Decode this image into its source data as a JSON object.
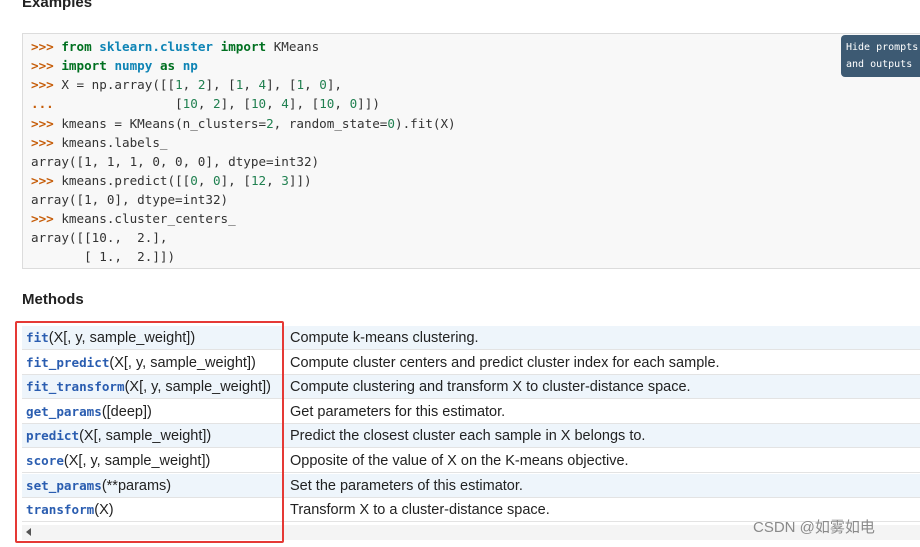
{
  "examples_heading": "Examples",
  "methods_heading": "Methods",
  "toggle_button": "Hide prompts\nand outputs",
  "methods": [
    {
      "name": "fit",
      "params": "(X[, y, sample_weight])",
      "description": "Compute k-means clustering."
    },
    {
      "name": "fit_predict",
      "params": "(X[, y, sample_weight])",
      "description": "Compute cluster centers and predict cluster index for each sample."
    },
    {
      "name": "fit_transform",
      "params": "(X[, y, sample_weight])",
      "description": "Compute clustering and transform X to cluster-distance space."
    },
    {
      "name": "get_params",
      "params": "([deep])",
      "description": "Get parameters for this estimator."
    },
    {
      "name": "predict",
      "params": "(X[, sample_weight])",
      "description": "Predict the closest cluster each sample in X belongs to."
    },
    {
      "name": "score",
      "params": "(X[, y, sample_weight])",
      "description": "Opposite of the value of X on the K-means objective."
    },
    {
      "name": "set_params",
      "params": "(**params)",
      "description": "Set the parameters of this estimator."
    },
    {
      "name": "transform",
      "params": "(X)",
      "description": "Transform X to a cluster-distance space."
    }
  ],
  "watermark": "CSDN @如雾如电",
  "colors": {
    "prompt": "#c65d09",
    "keyword": "#007020",
    "method_name": "#2a5db0",
    "highlight_border": "#e53935",
    "button_bg": "#3d5a73"
  },
  "icons": {
    "scroll_left": "scroll-left-arrow-icon"
  }
}
